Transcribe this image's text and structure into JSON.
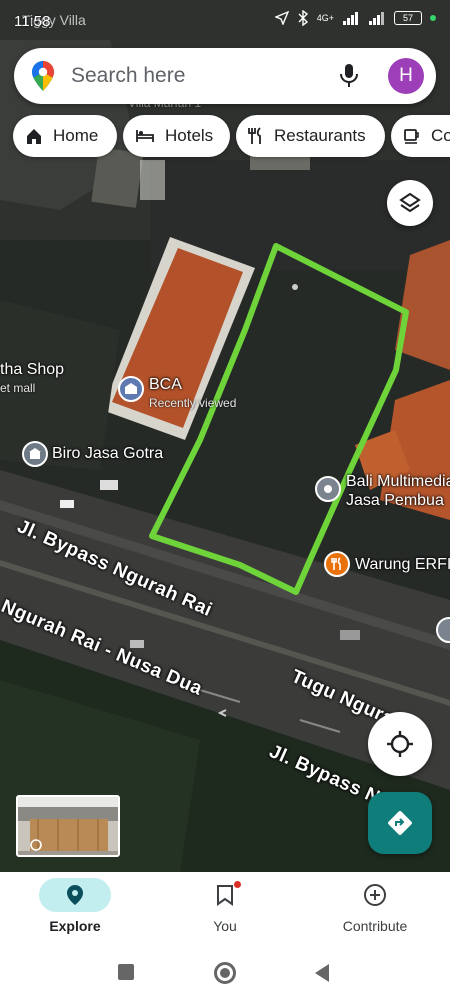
{
  "status_bar": {
    "time": "11:58",
    "background_label": "Tiggy Villa",
    "network": "4G+",
    "battery": "57"
  },
  "search": {
    "placeholder": "Search here",
    "avatar_letter": "H"
  },
  "chips": [
    {
      "label": "Home",
      "icon": "home-icon"
    },
    {
      "label": "Hotels",
      "icon": "bed-icon"
    },
    {
      "label": "Restaurants",
      "icon": "fork-knife-icon"
    },
    {
      "label": "Co",
      "icon": "coffee-icon"
    }
  ],
  "map": {
    "places": [
      {
        "name": "BCA",
        "sub": "Recently viewed",
        "icon": "bank-icon"
      },
      {
        "name": "Biro Jasa Gotra",
        "icon": "building-icon"
      },
      {
        "name": "Bali Multimedia",
        "sub": "Jasa Pembua",
        "icon": "pin-icon"
      },
      {
        "name": "Warung ERFIN",
        "icon": "restaurant-icon",
        "color": "#e8710a"
      },
      {
        "name": "tha Shop",
        "sub": "et mall"
      },
      {
        "name": "Villa Marfan 1"
      }
    ],
    "roads": [
      "Jl. Bypass Ngurah Rai",
      "Ngurah Rai - Nusa Dua",
      "Tugu Ngurah",
      "Jl. Bypass Ng"
    ],
    "highlight_color": "#6ed43a"
  },
  "bottom_nav": [
    {
      "label": "Explore",
      "icon": "location-pin-icon",
      "active": true
    },
    {
      "label": "You",
      "icon": "bookmark-icon",
      "badge": true
    },
    {
      "label": "Contribute",
      "icon": "plus-circle-icon"
    }
  ]
}
